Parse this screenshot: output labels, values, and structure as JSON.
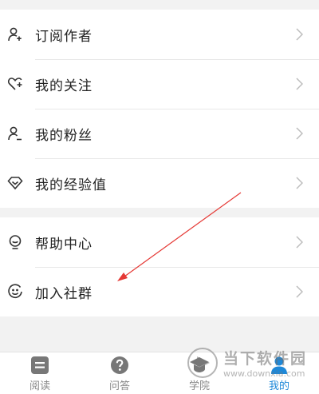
{
  "menu_group_1": [
    {
      "label": "订阅作者",
      "icon": "person-add-icon"
    },
    {
      "label": "我的关注",
      "icon": "heart-plus-icon"
    },
    {
      "label": "我的粉丝",
      "icon": "person-icon"
    },
    {
      "label": "我的经验值",
      "icon": "diamond-icon"
    }
  ],
  "menu_group_2": [
    {
      "label": "帮助中心",
      "icon": "help-bulb-icon"
    },
    {
      "label": "加入社群",
      "icon": "smile-icon"
    }
  ],
  "tabs": [
    {
      "label": "阅读",
      "icon": "doc-icon",
      "active": false
    },
    {
      "label": "问答",
      "icon": "question-icon",
      "active": false
    },
    {
      "label": "学院",
      "icon": "school-icon",
      "active": false
    },
    {
      "label": "我的",
      "icon": "profile-icon",
      "active": true
    }
  ],
  "watermark": {
    "name": "当下软件园",
    "url": "www.downxia.com"
  },
  "colors": {
    "accent": "#1e88d8",
    "arrow": "#e53935",
    "icon": "#333333",
    "chevron": "#bdbdbd"
  }
}
